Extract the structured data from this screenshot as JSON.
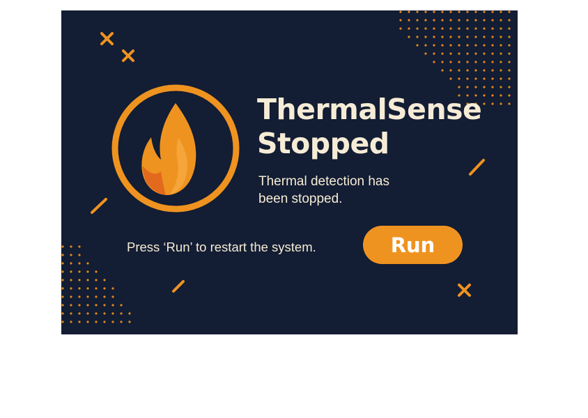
{
  "dialog": {
    "title_line1": "ThermalSense",
    "title_line2": "Stopped",
    "message": "Thermal detection has been stopped.",
    "hint": "Press ‘Run’ to restart the system.",
    "run_label": "Run"
  },
  "icons": {
    "logo": "flame-in-ring-icon",
    "decorations": [
      "x-mark-icon",
      "dash-icon",
      "dot-grid"
    ]
  },
  "colors": {
    "background": "#131d33",
    "accent": "#ef9320",
    "flame_dark": "#e2691d",
    "text": "#f6ecd6"
  }
}
